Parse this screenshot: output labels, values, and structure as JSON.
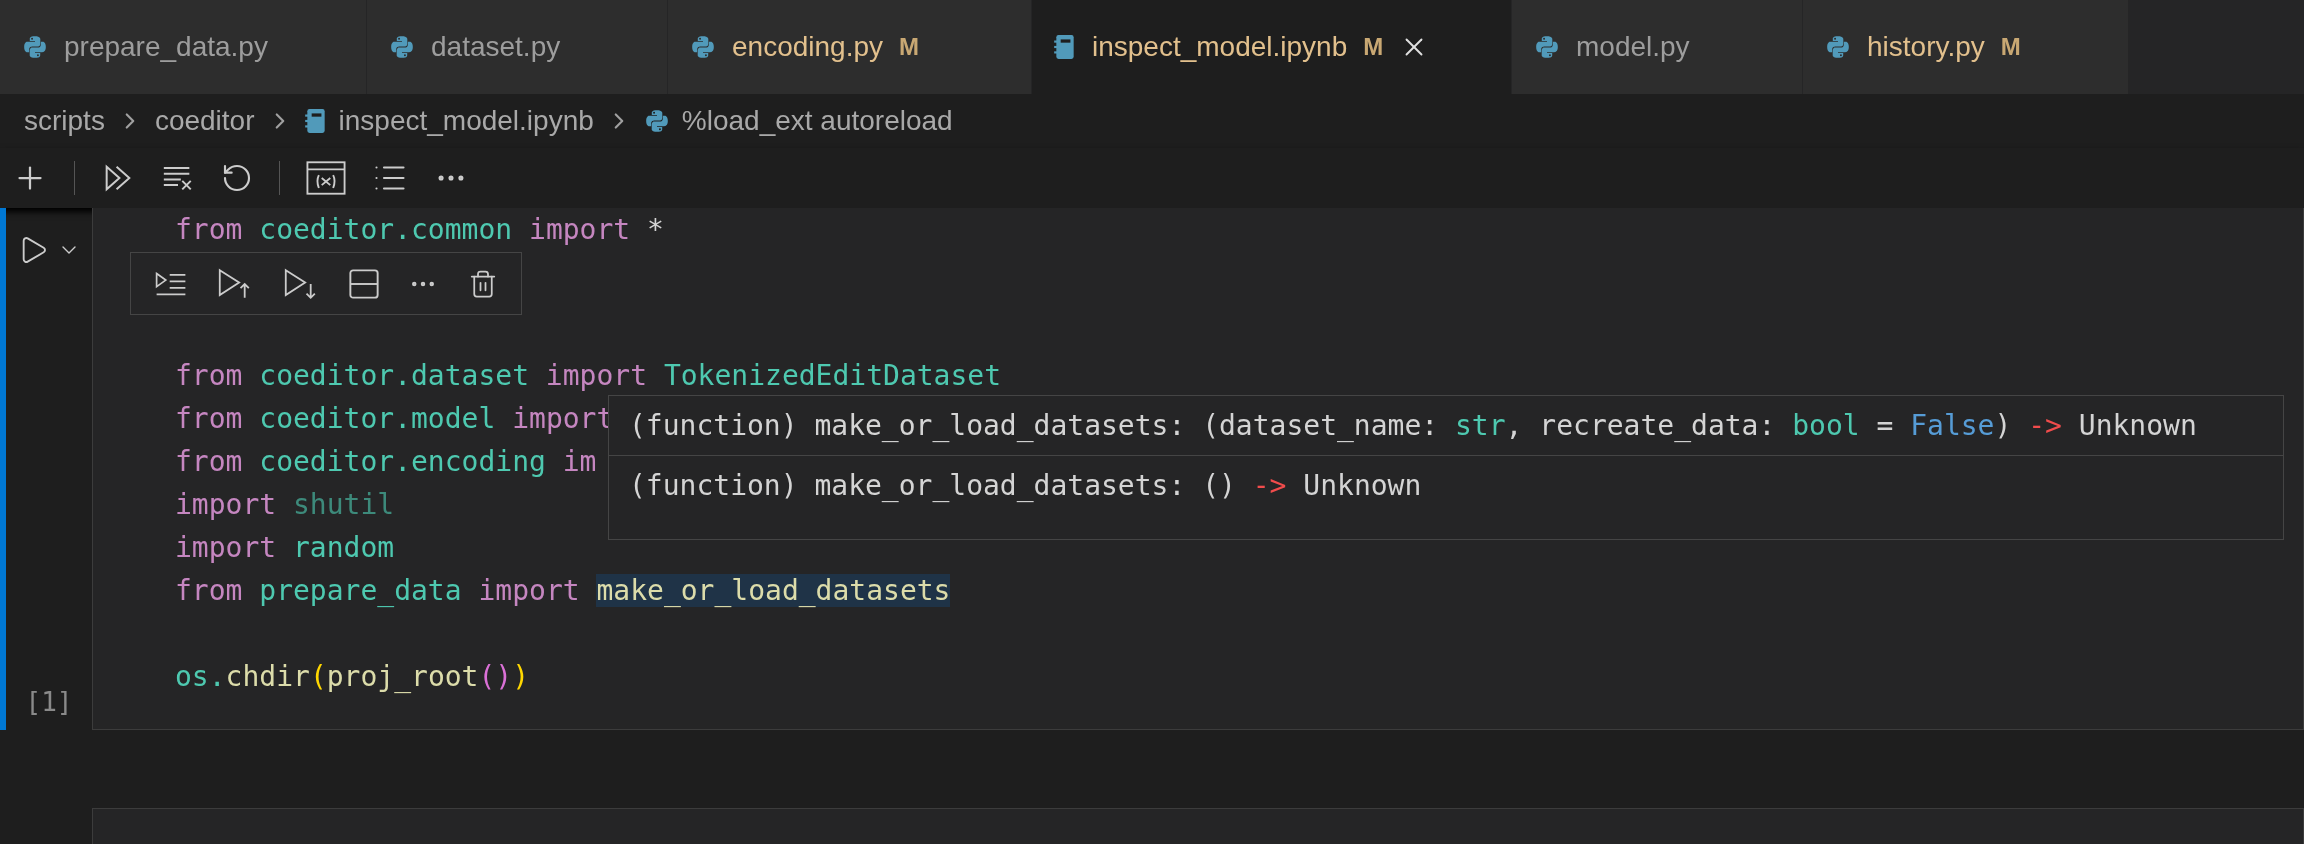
{
  "tabs": [
    {
      "label": "prepare_data.py",
      "kind": "python",
      "selected": false
    },
    {
      "label": "dataset.py",
      "kind": "python",
      "selected": false
    },
    {
      "label": "encoding.py",
      "kind": "python",
      "selected": false,
      "badge": "M"
    },
    {
      "label": "inspect_model.ipynb",
      "kind": "notebook",
      "selected": true,
      "badge": "M"
    },
    {
      "label": "model.py",
      "kind": "python",
      "selected": false
    },
    {
      "label": "history.py",
      "kind": "python",
      "selected": false,
      "badge": "M"
    }
  ],
  "breadcrumbs": [
    {
      "label": "scripts",
      "kind": "folder"
    },
    {
      "label": "coeditor",
      "kind": "folder"
    },
    {
      "label": "inspect_model.ipynb",
      "kind": "notebook"
    },
    {
      "label": "%load_ext autoreload",
      "kind": "python"
    }
  ],
  "cell": {
    "execution_count": "[1]",
    "lines": [
      {
        "kind": "code",
        "tokens": [
          {
            "text": "from ",
            "kind": "keyword"
          },
          {
            "text": "coeditor.common",
            "kind": "module"
          },
          {
            "text": " import ",
            "kind": "keyword"
          },
          {
            "text": "*",
            "kind": "plain"
          }
        ]
      },
      {
        "kind": "blank"
      },
      {
        "kind": "blank"
      },
      {
        "kind": "code",
        "tokens": [
          {
            "text": "from ",
            "kind": "keyword"
          },
          {
            "text": "coeditor.dataset",
            "kind": "module"
          },
          {
            "text": " import ",
            "kind": "keyword"
          },
          {
            "text": "TokenizedEditDataset",
            "kind": "module"
          }
        ]
      },
      {
        "kind": "code",
        "tokens": [
          {
            "text": "from ",
            "kind": "keyword"
          },
          {
            "text": "coeditor.model",
            "kind": "module"
          },
          {
            "text": " import",
            "kind": "keyword"
          }
        ]
      },
      {
        "kind": "code",
        "tokens": [
          {
            "text": "from ",
            "kind": "keyword"
          },
          {
            "text": "coeditor.encoding",
            "kind": "module"
          },
          {
            "text": " im",
            "kind": "keyword"
          }
        ]
      },
      {
        "kind": "code",
        "tokens": [
          {
            "text": "import ",
            "kind": "keyword"
          },
          {
            "text": "shutil",
            "kind": "unused"
          }
        ]
      },
      {
        "kind": "code",
        "tokens": [
          {
            "text": "import ",
            "kind": "keyword"
          },
          {
            "text": "random",
            "kind": "module"
          }
        ]
      },
      {
        "kind": "code",
        "tokens": [
          {
            "text": "from ",
            "kind": "keyword"
          },
          {
            "text": "prepare_data",
            "kind": "module"
          },
          {
            "text": " import ",
            "kind": "keyword"
          },
          {
            "text": "make_or_load_datasets",
            "kind": "function",
            "highlighted": true
          }
        ]
      },
      {
        "kind": "blank"
      },
      {
        "kind": "code",
        "tokens": [
          {
            "text": "os.",
            "kind": "module"
          },
          {
            "text": "chdir",
            "kind": "function"
          },
          {
            "text": "(",
            "kind": "bracket1"
          },
          {
            "text": "proj_root",
            "kind": "function"
          },
          {
            "text": "()",
            "kind": "bracket2"
          },
          {
            "text": ")",
            "kind": "bracket1"
          }
        ]
      }
    ]
  },
  "hover": {
    "rows": [
      {
        "parts": [
          {
            "text": "(function) make_or_load_datasets: (dataset_name: ",
            "kind": "plain"
          },
          {
            "text": "str",
            "kind": "type"
          },
          {
            "text": ", recreate_data: ",
            "kind": "plain"
          },
          {
            "text": "bool",
            "kind": "type"
          },
          {
            "text": " = ",
            "kind": "plain"
          },
          {
            "text": "False",
            "kind": "constant"
          },
          {
            "text": ") ",
            "kind": "plain"
          },
          {
            "text": "->",
            "kind": "arrow"
          },
          {
            "text": " Unknown",
            "kind": "plain"
          }
        ]
      },
      {
        "parts": [
          {
            "text": "(function) make_or_load_datasets: () ",
            "kind": "plain"
          },
          {
            "text": "->",
            "kind": "arrow"
          },
          {
            "text": " Unknown",
            "kind": "plain"
          }
        ]
      }
    ]
  }
}
